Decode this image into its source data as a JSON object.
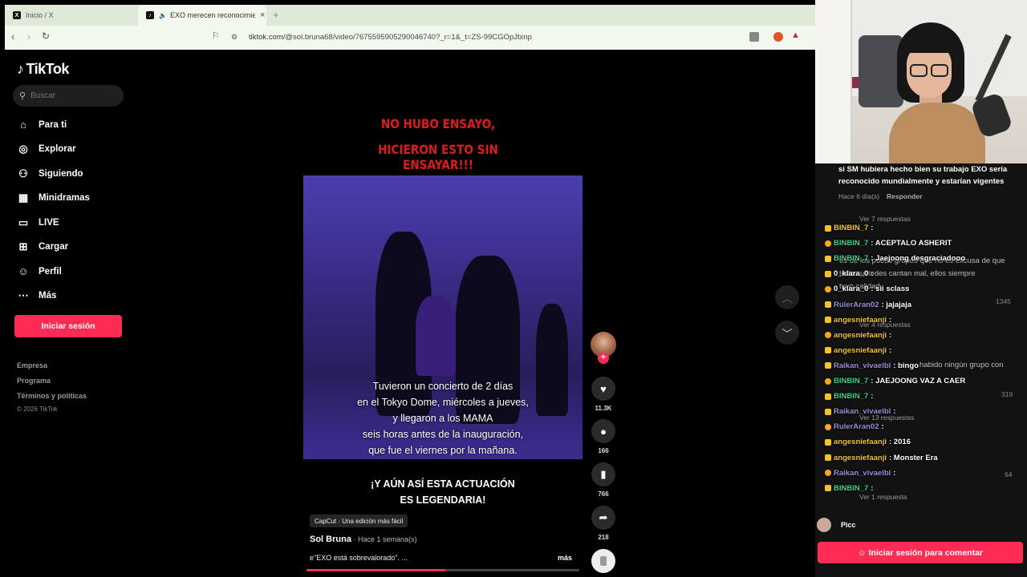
{
  "browser": {
    "tabs": [
      {
        "title": "Inicio / X",
        "favicon": "X"
      },
      {
        "title": "EXO merecen reconocimiento",
        "favicon": "TT"
      }
    ],
    "url_prefix": "tiktok.com/",
    "url_rest": "@sol.bruna68/video/7675595905290046740?_r=1&_t=ZS-99CGOpJtxnp"
  },
  "tiktok": {
    "brand": "TikTok",
    "search_placeholder": "Buscar",
    "nav": [
      "Para ti",
      "Explorar",
      "Siguiendo",
      "Minidramas",
      "LIVE",
      "Cargar",
      "Perfil",
      "Más"
    ],
    "login_label": "Iniciar sesión",
    "footer": [
      "Empresa",
      "Programa",
      "Términos y políticas"
    ],
    "copyright": "© 2026 TikTok"
  },
  "video": {
    "title_line1": "NO HUBO ENSAYO,",
    "title_line2": "HICIERON ESTO SIN ENSAYAR!!!",
    "caption": [
      "Tuvieron un concierto de 2 días",
      "en el Tokyo Dome, miércoles a jueves,",
      "y llegaron a los MAMA",
      "seis horas antes de la inauguración,",
      "que fue el viernes por la mañana."
    ],
    "subcaption_line1": "¡Y AÚN ASÍ ESTA ACTUACIÓN",
    "subcaption_line2": "ES LEGENDARIA!",
    "capcut": "CapCut · Una edición más fácil",
    "author": "Sol Bruna",
    "ago": " · Hace 1 semana(s)",
    "description": "e\"EXO está sobrevalorado\". ...",
    "more": "más",
    "progress": 0.51,
    "likes": "11.3K",
    "comments": "166",
    "saves": "766",
    "shares": "218"
  },
  "comments_panel": {
    "top_comment_line1": "si SM hubiera hecho bien su trabajo EXO sería",
    "top_comment_line2": "reconocido mundialmente y estarían vigentes",
    "top_meta": "Hace 6 día(s)",
    "reply_label": "Responder",
    "view_replies_7": "Ver 7 respuestas",
    "ghost_1": "es de los pocos grupos que no es excusa de que",
    "ghost_2": "todos ustedes cantan mal, ellos siempre",
    "ghost_3": "tuvo calidad",
    "ghost_likes_1": "1345",
    "view_replies_4": "Ver 4 respuestas",
    "ghost_4": "habido ningún grupo con",
    "ghost_likes_2": "319",
    "view_replies_13": "Ver 13 respuestas",
    "ghost_likes_3": "64",
    "view_replies_1": "Ver 1 respuesta",
    "picc": "Picc",
    "comment_login_label": "Iniciar sesión para comentar"
  },
  "chat": [
    {
      "user": "BINBIN_7",
      "text": ":",
      "color": "#f2c230"
    },
    {
      "user": "BINBIN_7",
      "text": ": ACEPTALO ASHERIT",
      "color": "#3fd08a"
    },
    {
      "user": "BINBIN_7",
      "text": ": Jaejoong desgraciadooo",
      "color": "#3fd08a"
    },
    {
      "user": "0_klara_0",
      "text": ":",
      "color": "#ffffff"
    },
    {
      "user": "0_klara_0",
      "text": ": sii sclass",
      "color": "#ffffff"
    },
    {
      "user": "RulerAran02",
      "text": ": jajajaja",
      "color": "#9b8dd6"
    },
    {
      "user": "angesniefaanji",
      "text": ":",
      "color": "#f2c230"
    },
    {
      "user": "angesniefaanji",
      "text": ":",
      "color": "#f2c230"
    },
    {
      "user": "angesniefaanji",
      "text": ":",
      "color": "#f2c230"
    },
    {
      "user": "Raikan_vivaelbl",
      "text": ": bingo",
      "color": "#9b8dd6"
    },
    {
      "user": "BINBIN_7",
      "text": ": JAEJOONG VAZ A CAER",
      "color": "#3fd08a"
    },
    {
      "user": "BINBIN_7",
      "text": ":",
      "color": "#3fd08a"
    },
    {
      "user": "Raikan_vivaelbl",
      "text": ":",
      "color": "#9b8dd6"
    },
    {
      "user": "RulerAran02",
      "text": ":",
      "color": "#9b8dd6"
    },
    {
      "user": "angesniefaanji",
      "text": ": 2016",
      "color": "#f2c230"
    },
    {
      "user": "angesniefaanji",
      "text": ": Monster Era",
      "color": "#f2c230"
    },
    {
      "user": "Raikan_vivaelbl",
      "text": ":",
      "color": "#9b8dd6"
    },
    {
      "user": "BINBIN_7",
      "text": ":",
      "color": "#3fd08a"
    }
  ]
}
